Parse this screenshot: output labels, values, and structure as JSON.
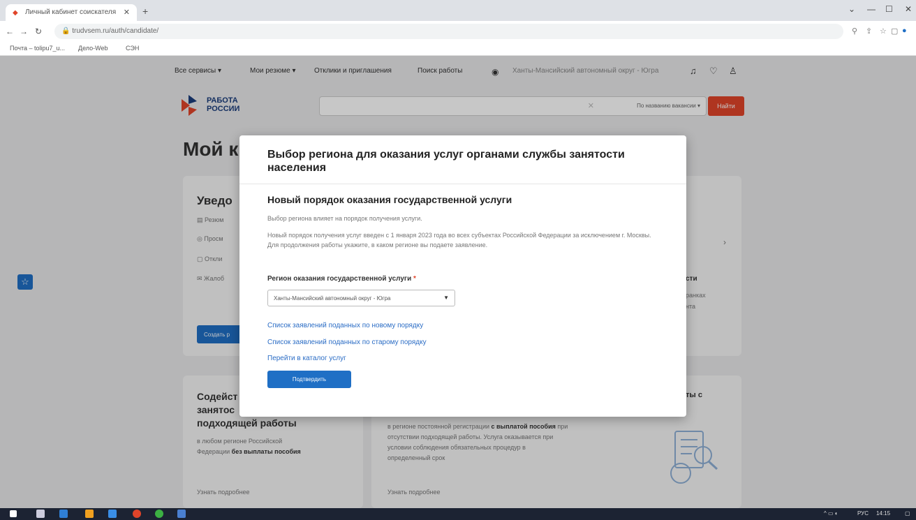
{
  "browser": {
    "tab_title": "Личный кабинет соискателя",
    "url": "trudvsem.ru/auth/candidate/",
    "bookmarks": [
      "Почта – tolipu7_u...",
      "Дело-Web",
      "СЭН"
    ]
  },
  "site": {
    "nav": [
      "Все сервисы ▾",
      "Мои резюме ▾",
      "Отклики и приглашения",
      "Поиск работы"
    ],
    "region": "Ханты-Мансийский автономный округ - Югра",
    "logo_line1": "РАБОТА",
    "logo_line2": "РОССИИ",
    "search_option": "По названию вакансии ▾",
    "search_button": "Найти",
    "page_title": "Мой к",
    "notify_title": "Уведо",
    "notify_items": [
      "Резюм",
      "Просм",
      "Откли",
      "Жалоб"
    ],
    "create_button": "Создать р",
    "card1_title_lines": [
      "Содейст",
      "занятос",
      "подходящей работы"
    ],
    "card1_desc_line1": "в любом регионе Российской",
    "card1_desc_prefix": "Федерации ",
    "card1_desc_bold": "без выплаты пособия",
    "card2_desc_prefix": "в регионе постоянной регистрации ",
    "card2_desc_bold": "с выплатой пособия",
    "card2_desc_suffix": " при",
    "card2_desc_lines": [
      "отсутствии подходящей работы. Услуга оказывается при",
      "условии соблюдения обязательных процедур в",
      "определенный срок"
    ],
    "more_link": "Узнать подробнее",
    "right_texts": [
      "сти",
      "ранках",
      "нта",
      "ты с"
    ]
  },
  "modal": {
    "title": "Выбор региона для оказания услуг органами службы занятости населения",
    "subtitle": "Новый порядок оказания государственной услуги",
    "para1": "Выбор региона влияет на порядок получения услуги.",
    "para2": "Новый порядок получения услуг введен с 1 января 2023 года во всех субъектах Российской Федерации за исключением г. Москвы. Для продолжения работы укажите, в каком регионе вы подаете заявление.",
    "field_label": "Регион оказания государственной услуги",
    "required_mark": "*",
    "select_value": "Ханты-Мансийский автономный округ - Югра",
    "links": [
      "Список заявлений поданных по новому порядку",
      "Список заявлений поданных по старому порядку",
      "Перейти в каталог услуг"
    ],
    "confirm_button": "Подтвердить"
  },
  "taskbar": {
    "lang": "РУС",
    "time": "14:15"
  }
}
